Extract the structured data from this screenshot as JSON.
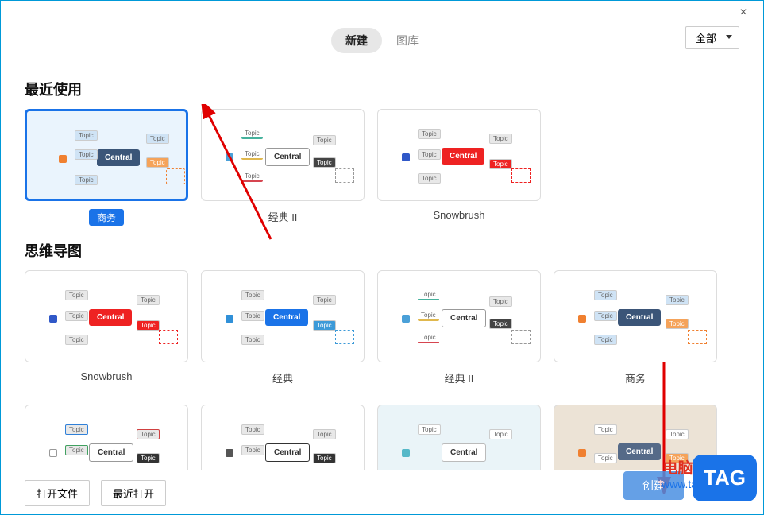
{
  "window": {
    "close_icon": "×"
  },
  "topbar": {
    "tabs": [
      {
        "label": "新建",
        "active": true
      },
      {
        "label": "图库",
        "active": false
      }
    ],
    "filter": "全部"
  },
  "sections": {
    "recent": {
      "title": "最近使用",
      "items": [
        {
          "label": "商务",
          "selected": true,
          "style": "business",
          "central": "Central",
          "topic": "Topic"
        },
        {
          "label": "经典 II",
          "style": "classic2",
          "central": "Central",
          "topic": "Topic"
        },
        {
          "label": "Snowbrush",
          "style": "snowbrush",
          "central": "Central",
          "topic": "Topic"
        }
      ]
    },
    "mindmap": {
      "title": "思维导图",
      "items": [
        {
          "label": "Snowbrush",
          "style": "snowbrush",
          "central": "Central",
          "topic": "Topic"
        },
        {
          "label": "经典",
          "style": "classic",
          "central": "Central",
          "topic": "Topic"
        },
        {
          "label": "经典 II",
          "style": "classic2",
          "central": "Central",
          "topic": "Topic"
        },
        {
          "label": "商务",
          "style": "business-plain",
          "central": "Central",
          "topic": "Topic"
        },
        {
          "label": "",
          "style": "plain1",
          "central": "Central",
          "topic": "Topic"
        },
        {
          "label": "",
          "style": "plain2",
          "central": "Central",
          "topic": "Topic"
        },
        {
          "label": "",
          "style": "plain3",
          "central": "Central",
          "topic": "Topic"
        },
        {
          "label": "",
          "style": "plain4",
          "central": "Central",
          "topic": "Topic"
        }
      ]
    }
  },
  "buttons": {
    "open_file": "打开文件",
    "recent_open": "最近打开",
    "create": "创建"
  },
  "watermark": {
    "line1": "电脑技术网",
    "line2": "www.tagxp.com",
    "tag": "TAG"
  }
}
